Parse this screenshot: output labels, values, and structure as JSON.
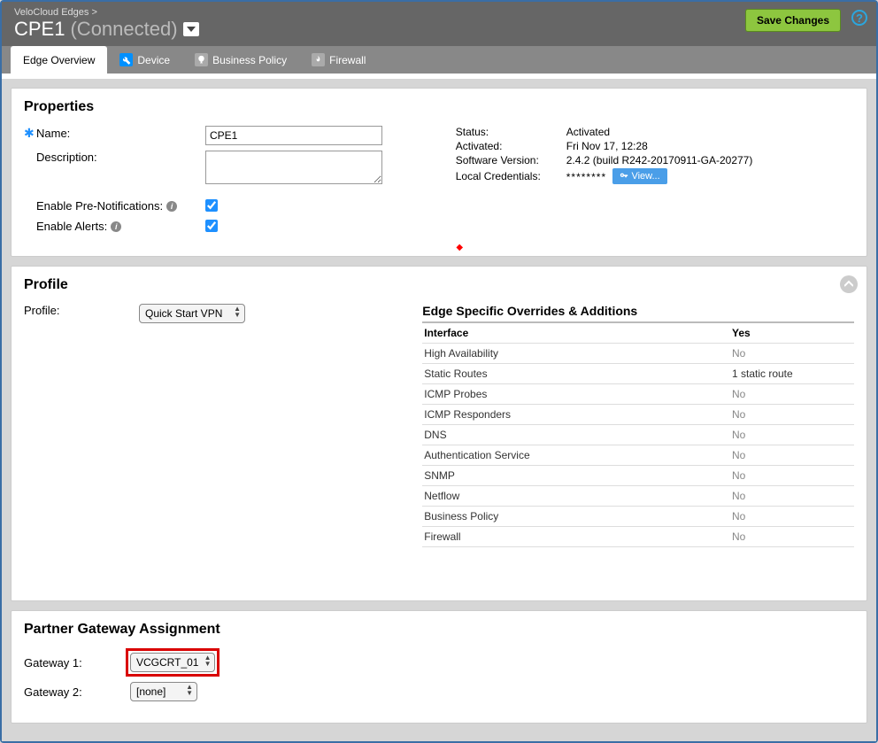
{
  "header": {
    "breadcrumb": "VeloCloud Edges >",
    "title": "CPE1",
    "connection_status": "(Connected)",
    "save_label": "Save Changes"
  },
  "tabs": {
    "overview": "Edge Overview",
    "device": "Device",
    "policy": "Business Policy",
    "firewall": "Firewall"
  },
  "properties": {
    "panel_title": "Properties",
    "name_label": "Name:",
    "name_value": "CPE1",
    "description_label": "Description:",
    "description_value": "",
    "pre_notif_label": "Enable Pre-Notifications:",
    "alerts_label": "Enable Alerts:",
    "status": {
      "status_label": "Status:",
      "status_value": "Activated",
      "activated_label": "Activated:",
      "activated_value": "Fri Nov 17, 12:28",
      "version_label": "Software Version:",
      "version_value": "2.4.2 (build R242-20170911-GA-20277)",
      "cred_label": "Local Credentials:",
      "cred_value": "********",
      "view_label": "View..."
    }
  },
  "profile": {
    "panel_title": "Profile",
    "profile_label": "Profile:",
    "profile_value": "Quick Start VPN",
    "overrides_title": "Edge Specific Overrides & Additions",
    "header_name": "Interface",
    "header_val": "Yes",
    "rows": [
      {
        "name": "High Availability",
        "val": "No"
      },
      {
        "name": "Static Routes",
        "val": "1 static route"
      },
      {
        "name": "ICMP Probes",
        "val": "No"
      },
      {
        "name": "ICMP Responders",
        "val": "No"
      },
      {
        "name": "DNS",
        "val": "No"
      },
      {
        "name": "Authentication Service",
        "val": "No"
      },
      {
        "name": "SNMP",
        "val": "No"
      },
      {
        "name": "Netflow",
        "val": "No"
      },
      {
        "name": "Business Policy",
        "val": "No"
      },
      {
        "name": "Firewall",
        "val": "No"
      }
    ]
  },
  "gateway": {
    "panel_title": "Partner Gateway Assignment",
    "gw1_label": "Gateway 1:",
    "gw1_value": "VCGCRT_01",
    "gw2_label": "Gateway 2:",
    "gw2_value": "[none]"
  }
}
